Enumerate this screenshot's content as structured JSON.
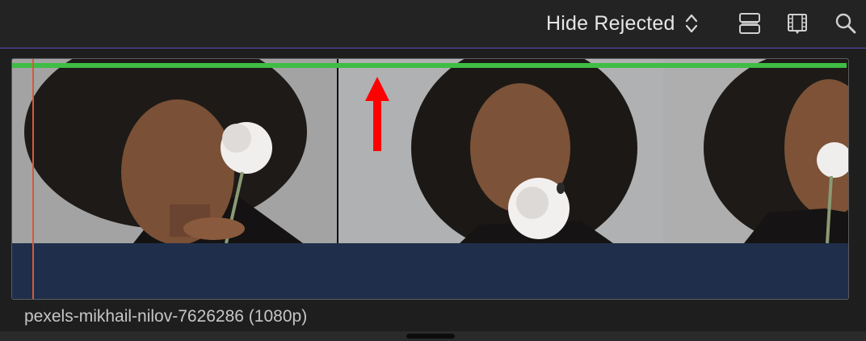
{
  "toolbar": {
    "filter_label": "Hide Rejected",
    "icons": [
      "chevron-updown-icon",
      "clip-appearance-icon",
      "filmstrip-icon",
      "search-icon"
    ]
  },
  "clip": {
    "name": "pexels-mikhail-nilov-7626286 (1080p)",
    "rating": "favorite",
    "colors": {
      "favorite_bar": "#3fbd45",
      "playhead": "#d65a3a",
      "audio_area": "#1f2f4b",
      "annotation_arrow": "#ff0000",
      "accent_line": "#5a4fc0"
    }
  }
}
